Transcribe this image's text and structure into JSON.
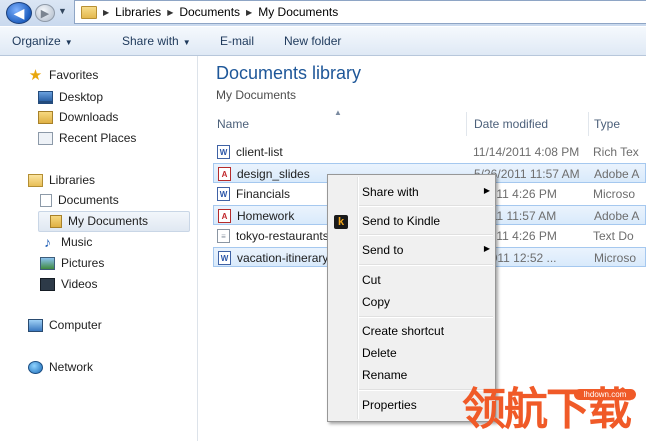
{
  "address_bar": {
    "back_glyph": "◀",
    "forward_glyph": "▶",
    "recent_glyph": "▼",
    "separator_glyph": "▶",
    "crumbs": [
      "Libraries",
      "Documents",
      "My Documents"
    ]
  },
  "toolbar": {
    "organize_label": "Organize",
    "share_label": "Share with",
    "email_label": "E-mail",
    "new_folder_label": "New folder",
    "dropdown_glyph": "▼"
  },
  "nav": {
    "favorites": "Favorites",
    "desktop": "Desktop",
    "downloads": "Downloads",
    "recent": "Recent Places",
    "libraries": "Libraries",
    "documents": "Documents",
    "my_documents": "My Documents",
    "music": "Music",
    "pictures": "Pictures",
    "videos": "Videos",
    "computer": "Computer",
    "network": "Network",
    "star_glyph": "★",
    "music_glyph": "♪"
  },
  "content": {
    "title": "Documents library",
    "subtitle": "My Documents",
    "columns": {
      "name": "Name",
      "date": "Date modified",
      "type": "Type",
      "sort_glyph": "▲"
    },
    "files": [
      {
        "name": "client-list",
        "date": "11/14/2011 4:08 PM",
        "type": "Rich Tex",
        "icon": "word-doc-icon",
        "selected": false
      },
      {
        "name": "design_slides",
        "date": "5/26/2011 11:57 AM",
        "type": "Adobe A",
        "icon": "pdf-icon",
        "selected": true
      },
      {
        "name": "Financials",
        "date": "8/2011 4:26 PM",
        "type": "Microso",
        "icon": "word-doc-icon",
        "selected": false
      },
      {
        "name": "Homework",
        "date": "/2011 11:57 AM",
        "type": "Adobe A",
        "icon": "pdf-icon",
        "selected": true
      },
      {
        "name": "tokyo-restaurants",
        "date": "8/2011 4:26 PM",
        "type": "Text Do",
        "icon": "text-doc-icon",
        "selected": false
      },
      {
        "name": "vacation-itinerary",
        "date": "7/2011 12:52 ...",
        "type": "Microso",
        "icon": "word-doc-icon",
        "selected": true
      }
    ]
  },
  "context_menu": {
    "share_with": "Share with",
    "send_to_kindle": "Send to Kindle",
    "kindle_glyph": "k",
    "send_to": "Send to",
    "cut": "Cut",
    "copy": "Copy",
    "create_shortcut": "Create shortcut",
    "delete": "Delete",
    "rename": "Rename",
    "properties": "Properties",
    "submenu_glyph": "▶"
  },
  "watermark": {
    "text": "领航下载",
    "url": "lhdown.com"
  }
}
